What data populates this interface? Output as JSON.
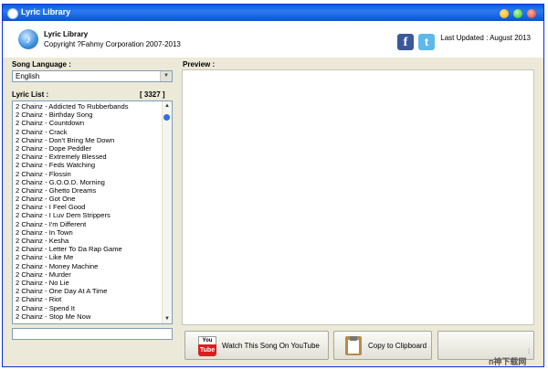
{
  "window": {
    "title": "Lyric Library"
  },
  "header": {
    "app_name": "Lyric Library",
    "copyright": "Copyright ?Fahmy Corporation 2007-2013",
    "last_updated": "Last Updated : August 2013",
    "facebook_letter": "f",
    "twitter_letter": "t",
    "logo_glyph": "♪"
  },
  "language": {
    "label": "Song Language :",
    "selected": "English"
  },
  "lyric_list": {
    "label": "Lyric List :",
    "count": "[ 3327 ]",
    "items": [
      "2 Chainz - Addicted To Rubberbands",
      "2 Chainz - Birthday Song",
      "2 Chainz - Countdown",
      "2 Chainz - Crack",
      "2 Chainz - Don't Bring Me Down",
      "2 Chainz - Dope Peddler",
      "2 Chainz - Extremely Blessed",
      "2 Chainz - Feds Watching",
      "2 Chainz - Flossin",
      "2 Chainz - G.O.O.D. Morning",
      "2 Chainz - Ghetto Dreams",
      "2 Chainz - Got One",
      "2 Chainz - I Feel Good",
      "2 Chainz - I Luv Dem Strippers",
      "2 Chainz - I'm Different",
      "2 Chainz - In Town",
      "2 Chainz - Kesha",
      "2 Chainz - Letter To Da Rap Game",
      "2 Chainz - Like Me",
      "2 Chainz - Money Machine",
      "2 Chainz - Murder",
      "2 Chainz - No Lie",
      "2 Chainz - One Day At A Time",
      "2 Chainz - Riot",
      "2 Chainz - Spend It",
      "2 Chainz - Stop Me Now"
    ]
  },
  "preview": {
    "label": "Preview :"
  },
  "buttons": {
    "youtube": "Watch This Song On YouTube",
    "youtube_icon_top": "You",
    "youtube_icon_bottom": "Tube",
    "clipboard": "Copy to Clipboard"
  },
  "watermark": "п神下载网",
  "colors": {
    "title_bar": "#0a5fd8",
    "facebook": "#3b5998",
    "twitter": "#5fb8ea",
    "youtube": "#d62020"
  }
}
